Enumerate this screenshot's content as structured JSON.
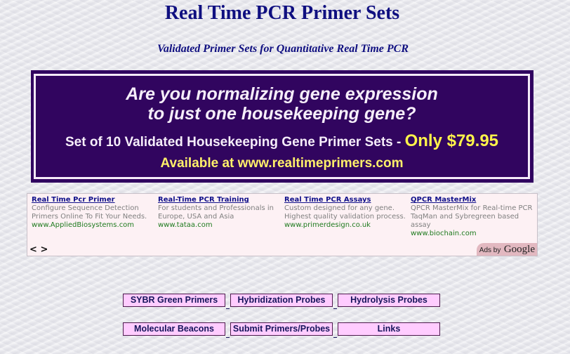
{
  "header": {
    "title": "Real Time PCR Primer Sets",
    "subtitle": "Validated Primer Sets for Quantitative Real Time PCR"
  },
  "banner": {
    "line1": "Are you normalizing gene expression",
    "line2": "to just one housekeeping gene?",
    "line3_text": "Set of 10 Validated Housekeeping Gene Primer Sets - ",
    "line3_price": "Only $79.95",
    "line4": "Available at www.realtimeprimers.com",
    "colors": {
      "background": "#31055f",
      "text": "#f6eefa",
      "highlight": "#fff34a"
    }
  },
  "ads": {
    "items": [
      {
        "title": "Real Time Pcr Primer",
        "description": "Configure Sequence Detection Primers Online To Fit Your Needs.",
        "url": "www.AppliedBiosystems.com"
      },
      {
        "title": "Real-Time PCR Training",
        "description": "For students and Professionals in Europe, USA and Asia",
        "url": "www.tataa.com"
      },
      {
        "title": "Real Time PCR Assays",
        "description": "Custom designed for any gene. Highest quality validation process.",
        "url": "www.primerdesign.co.uk"
      },
      {
        "title": "QPCR MasterMix",
        "description": "QPCR MasterMix for Real-time PCR TaqMan and Sybregreen based assay",
        "url": "www.biochain.com"
      }
    ],
    "nav_prev": "<",
    "nav_next": ">",
    "attribution_prefix": "Ads by",
    "attribution_brand": "Google"
  },
  "nav": {
    "row1": [
      "SYBR Green Primers",
      "Hybridization Probes",
      "Hydrolysis Probes"
    ],
    "row2": [
      "Molecular Beacons",
      "Submit Primers/Probes",
      "Links"
    ],
    "colors": {
      "button_bg": "#ffccff",
      "button_text": "#14145a"
    }
  }
}
